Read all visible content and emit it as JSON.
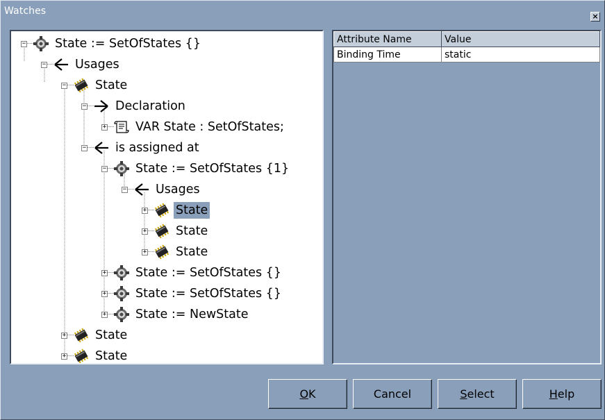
{
  "window": {
    "title": "Watches",
    "close_glyph": "×"
  },
  "tree": {
    "nodes": [
      {
        "label": "State := SetOfStates {}",
        "icon": "gear-icon",
        "expander": "minus"
      },
      {
        "label": "Usages",
        "icon": "usages-arrow-icon",
        "expander": "minus"
      },
      {
        "label": "State",
        "icon": "chip-icon",
        "expander": "minus"
      },
      {
        "label": "Declaration",
        "icon": "declaration-arrow-icon",
        "expander": "minus"
      },
      {
        "label": "VAR State : SetOfStates;",
        "icon": "scroll-icon",
        "expander": "plus"
      },
      {
        "label": "is assigned at",
        "icon": "usages-arrow-icon",
        "expander": "minus"
      },
      {
        "label": "State := SetOfStates {1}",
        "icon": "gear-icon",
        "expander": "minus"
      },
      {
        "label": "Usages",
        "icon": "usages-arrow-icon",
        "expander": "minus"
      },
      {
        "label": "State",
        "icon": "chip-icon",
        "expander": "plus",
        "selected": true
      },
      {
        "label": "State",
        "icon": "chip-icon",
        "expander": "plus"
      },
      {
        "label": "State",
        "icon": "chip-icon",
        "expander": "plus"
      },
      {
        "label": "State := SetOfStates {}",
        "icon": "gear-icon",
        "expander": "plus"
      },
      {
        "label": "State := SetOfStates {}",
        "icon": "gear-icon",
        "expander": "plus"
      },
      {
        "label": "State := NewState",
        "icon": "gear-icon",
        "expander": "plus"
      },
      {
        "label": "State",
        "icon": "chip-icon",
        "expander": "plus"
      },
      {
        "label": "State",
        "icon": "chip-icon",
        "expander": "plus"
      }
    ]
  },
  "attributes": {
    "headers": {
      "name": "Attribute Name",
      "value": "Value"
    },
    "rows": [
      {
        "name": "Binding Time",
        "value": "static"
      }
    ]
  },
  "buttons": {
    "ok": {
      "accel": "O",
      "rest": "K"
    },
    "cancel": {
      "label": "Cancel"
    },
    "select": {
      "accel": "S",
      "rest": "elect"
    },
    "help": {
      "accel": "H",
      "rest": "elp"
    }
  },
  "colors": {
    "background": "#8a9fba",
    "selection": "#8a9fba"
  }
}
